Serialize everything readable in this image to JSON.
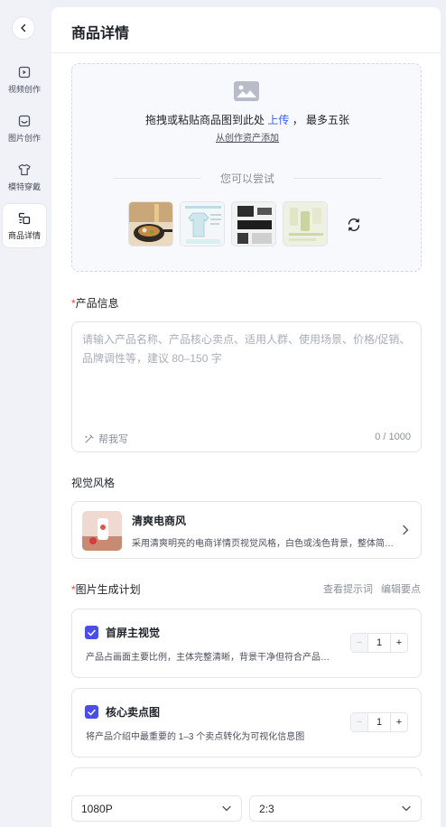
{
  "sidebar": {
    "items": [
      {
        "label": "视频创作",
        "icon": "video-create-icon"
      },
      {
        "label": "图片创作",
        "icon": "image-create-icon"
      },
      {
        "label": "模特穿戴",
        "icon": "tshirt-icon"
      },
      {
        "label": "商品详情",
        "icon": "product-detail-icon",
        "active": true
      }
    ]
  },
  "header": {
    "title": "商品详情"
  },
  "upload": {
    "text_prefix": "拖拽或粘贴商品图到此处",
    "upload_link": "上传",
    "text_suffix": "，  最多五张",
    "asset_link": "从创作资产添加",
    "try_label": "您可以尝试",
    "samples": [
      "pan-food-sample",
      "clothing-detail-sample",
      "electronics-sample",
      "bottle-sample"
    ]
  },
  "product_info": {
    "label": "产品信息",
    "required_mark": "*",
    "placeholder": "请输入产品名称、产品核心卖点、适用人群、使用场景、价格/促销、品牌调性等，建议 80–150 字",
    "help_write": "帮我写",
    "counter": "0 / 1000"
  },
  "visual_style": {
    "label": "视觉风格",
    "name": "清爽电商风",
    "description": "采用清爽明亮的电商详情页视觉风格，白色或浅色背景，整体简洁清新"
  },
  "plan": {
    "label": "图片生成计划",
    "required_mark": "*",
    "view_prompt": "查看提示词",
    "edit_points": "编辑要点",
    "items": [
      {
        "title": "首屏主视觉",
        "description": "产品占画面主要比例，主体完整清晰，背景干净但符合产品调性",
        "qty": "1",
        "checked": true
      },
      {
        "title": "核心卖点图",
        "description": "将产品介绍中最重要的 1–3 个卖点转化为可视化信息图",
        "qty": "1",
        "checked": true
      }
    ],
    "minus": "−",
    "plus": "+"
  },
  "settings": {
    "resolution": "1080P",
    "ratio": "2:3"
  },
  "colors": {
    "accent": "#3d5cf5",
    "checkbox": "#4a4de8",
    "required": "#e5443b"
  }
}
